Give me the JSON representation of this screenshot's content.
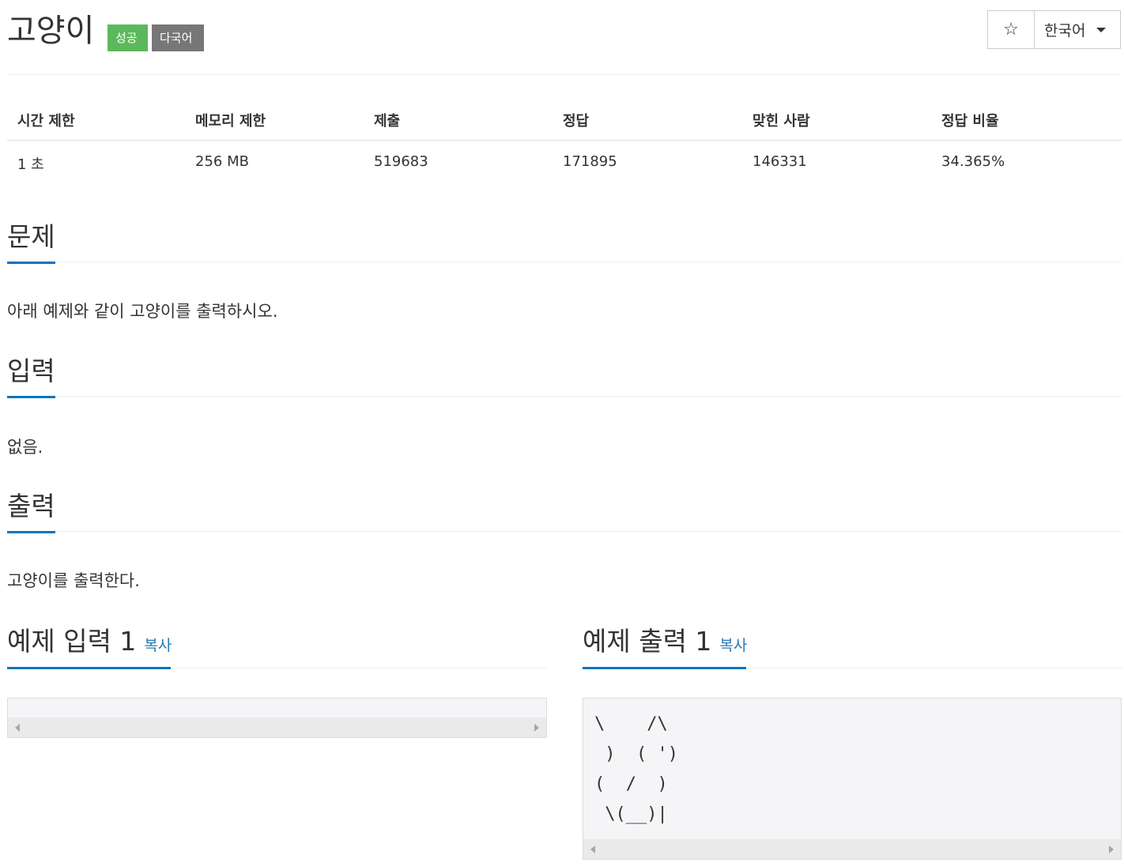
{
  "problem": {
    "title": "고양이",
    "badges": {
      "success": "성공",
      "multilang": "다국어"
    }
  },
  "toolbar": {
    "star_icon": "☆",
    "language": "한국어"
  },
  "stats": {
    "headers": [
      "시간 제한",
      "메모리 제한",
      "제출",
      "정답",
      "맞힌 사람",
      "정답 비율"
    ],
    "values": [
      "1 초",
      "256 MB",
      "519683",
      "171895",
      "146331",
      "34.365%"
    ]
  },
  "sections": {
    "problem": {
      "heading": "문제",
      "text": "아래 예제와 같이 고양이를 출력하시오."
    },
    "input": {
      "heading": "입력",
      "text": "없음."
    },
    "output": {
      "heading": "출력",
      "text": "고양이를 출력한다."
    }
  },
  "samples": {
    "input": {
      "heading": "예제 입력 1",
      "copy": "복사",
      "content": ""
    },
    "output": {
      "heading": "예제 출력 1",
      "copy": "복사",
      "content": "\\    /\\\n )  ( ')\n(  /  )\n \\(__)|"
    }
  },
  "colors": {
    "success_badge": "#5cb85c",
    "multilang_badge": "#777777",
    "accent": "#0076c0",
    "link": "#2a7ab5"
  }
}
